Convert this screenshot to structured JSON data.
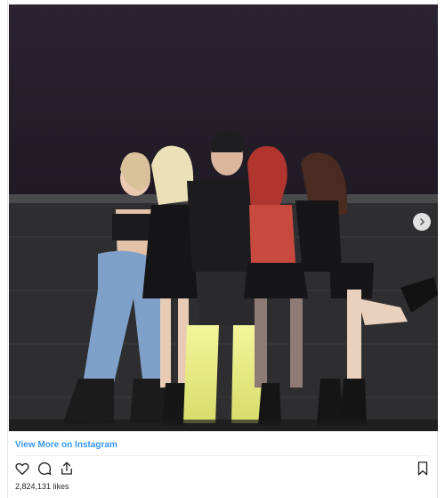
{
  "post": {
    "view_more_label": "View More on Instagram",
    "likes_text": "2,824,131 likes"
  },
  "icons": {
    "like": "heart-outline-icon",
    "comment": "comment-bubble-icon",
    "share": "share-upload-icon",
    "save": "bookmark-icon",
    "next": "chevron-right-icon"
  },
  "colors": {
    "link": "#3897f0",
    "text": "#262626",
    "stage_backdrop": "#251f2a"
  }
}
